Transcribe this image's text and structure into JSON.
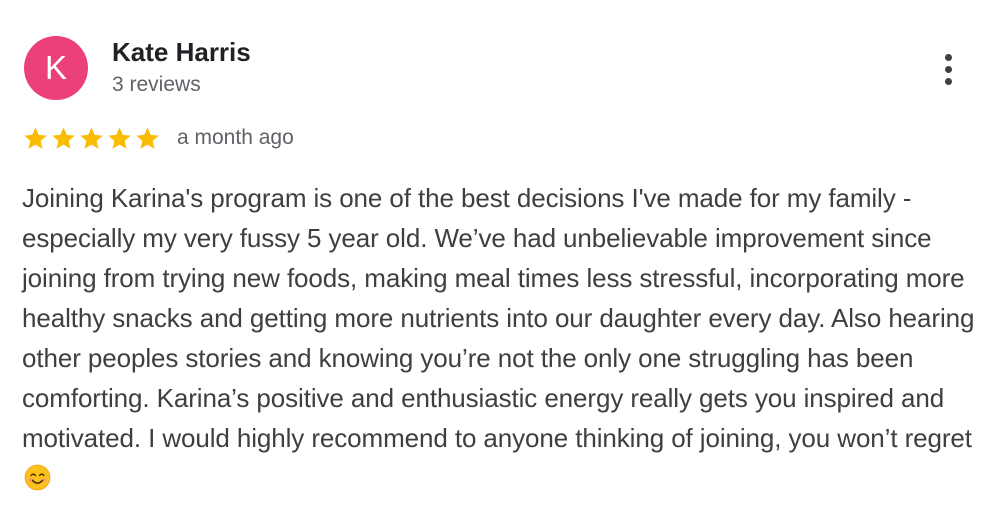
{
  "reviewer": {
    "initial": "K",
    "name": "Kate Harris",
    "reviews_count": "3 reviews",
    "avatar_color": "#ec407a"
  },
  "rating": {
    "stars": 5,
    "max_stars": 5,
    "star_color": "#fbbc04",
    "date": "a month ago"
  },
  "review": {
    "text": "Joining Karina's program is one of the best decisions I've made for my family - especially my very fussy 5 year old. We’ve had unbelievable improvement since joining from trying new foods, making meal times less stressful, incorporating more healthy snacks and getting more nutrients into our daughter every day. Also hearing other peoples stories and knowing you’re not the only one struggling has been comforting. Karina’s positive and enthusiastic energy really gets you inspired and motivated. I would highly recommend to anyone thinking of joining, you won’t regret",
    "trailing_emoji": "smiling-face-emoji"
  },
  "menu": {
    "icon": "more-vert-icon"
  }
}
